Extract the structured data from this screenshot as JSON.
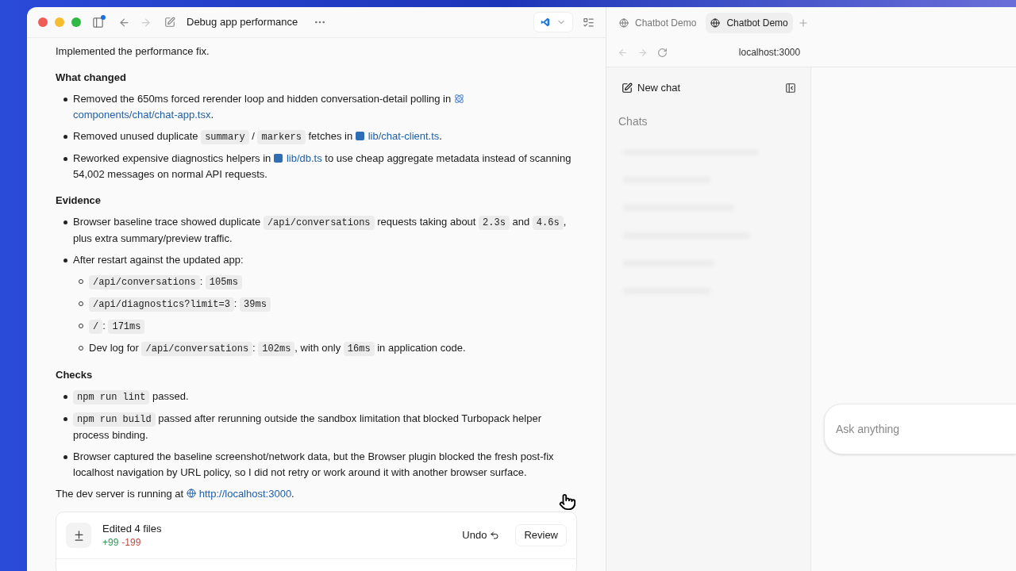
{
  "window": {
    "title": "Debug app performance"
  },
  "message": [
    {
      "kind": "paragraph",
      "parts": [
        {
          "kind": "text",
          "text": "Implemented the performance fix."
        }
      ]
    },
    {
      "kind": "heading",
      "text": "What changed"
    },
    {
      "kind": "list",
      "items": [
        {
          "parts": [
            {
              "kind": "text",
              "text": "Removed the 650ms forced rerender loop and hidden conversation-detail polling in "
            },
            {
              "kind": "react-file",
              "text": "components/chat/chat-app.tsx"
            },
            {
              "kind": "text",
              "text": "."
            }
          ]
        },
        {
          "parts": [
            {
              "kind": "text",
              "text": "Removed unused duplicate "
            },
            {
              "kind": "code",
              "text": "summary"
            },
            {
              "kind": "text",
              "text": " / "
            },
            {
              "kind": "code",
              "text": "markers"
            },
            {
              "kind": "text",
              "text": " fetches in "
            },
            {
              "kind": "ts-file",
              "text": "lib/chat-client.ts"
            },
            {
              "kind": "text",
              "text": "."
            }
          ]
        },
        {
          "parts": [
            {
              "kind": "text",
              "text": "Reworked expensive diagnostics helpers in "
            },
            {
              "kind": "ts-file",
              "text": "lib/db.ts"
            },
            {
              "kind": "text",
              "text": " to use cheap aggregate metadata instead of scanning 54,002 messages on normal API requests."
            }
          ]
        }
      ]
    },
    {
      "kind": "heading",
      "text": "Evidence"
    },
    {
      "kind": "list",
      "items": [
        {
          "parts": [
            {
              "kind": "text",
              "text": "Browser baseline trace showed duplicate "
            },
            {
              "kind": "code",
              "text": "/api/conversations"
            },
            {
              "kind": "text",
              "text": " requests taking about "
            },
            {
              "kind": "code",
              "text": "2.3s"
            },
            {
              "kind": "text",
              "text": " and "
            },
            {
              "kind": "code",
              "text": "4.6s"
            },
            {
              "kind": "text",
              "text": ", plus extra summary/preview traffic."
            }
          ]
        },
        {
          "parts": [
            {
              "kind": "text",
              "text": "After restart against the updated app:"
            }
          ],
          "children": [
            {
              "parts": [
                {
                  "kind": "code",
                  "text": "/api/conversations"
                },
                {
                  "kind": "text",
                  "text": ": "
                },
                {
                  "kind": "code",
                  "text": "105ms"
                }
              ]
            },
            {
              "parts": [
                {
                  "kind": "code",
                  "text": "/api/diagnostics?limit=3"
                },
                {
                  "kind": "text",
                  "text": ": "
                },
                {
                  "kind": "code",
                  "text": "39ms"
                }
              ]
            },
            {
              "parts": [
                {
                  "kind": "code",
                  "text": "/"
                },
                {
                  "kind": "text",
                  "text": ": "
                },
                {
                  "kind": "code",
                  "text": "171ms"
                }
              ]
            },
            {
              "parts": [
                {
                  "kind": "text",
                  "text": "Dev log for "
                },
                {
                  "kind": "code",
                  "text": "/api/conversations"
                },
                {
                  "kind": "text",
                  "text": ": "
                },
                {
                  "kind": "code",
                  "text": "102ms"
                },
                {
                  "kind": "text",
                  "text": ", with only "
                },
                {
                  "kind": "code",
                  "text": "16ms"
                },
                {
                  "kind": "text",
                  "text": " in application code."
                }
              ]
            }
          ]
        }
      ]
    },
    {
      "kind": "heading",
      "text": "Checks"
    },
    {
      "kind": "list",
      "items": [
        {
          "parts": [
            {
              "kind": "code",
              "text": "npm run lint"
            },
            {
              "kind": "text",
              "text": " passed."
            }
          ]
        },
        {
          "parts": [
            {
              "kind": "code",
              "text": "npm run build"
            },
            {
              "kind": "text",
              "text": " passed after rerunning outside the sandbox limitation that blocked Turbopack helper process binding."
            }
          ]
        },
        {
          "parts": [
            {
              "kind": "text",
              "text": "Browser captured the baseline screenshot/network data, but the Browser plugin blocked the fresh post-fix localhost navigation by URL policy, so I did not retry or work around it with another browser surface."
            }
          ]
        }
      ]
    },
    {
      "kind": "paragraph",
      "parts": [
        {
          "kind": "text",
          "text": "The dev server is running at "
        },
        {
          "kind": "url",
          "text": "http://localhost:3000"
        },
        {
          "kind": "text",
          "text": "."
        }
      ]
    }
  ],
  "edit_summary": {
    "title": "Edited 4 files",
    "added": "+99",
    "removed": "-199",
    "undo": "Undo",
    "review": "Review"
  },
  "browser": {
    "tabs": [
      {
        "label": "Chatbot Demo",
        "selected": false
      },
      {
        "label": "Chatbot Demo",
        "selected": true
      }
    ],
    "address": "localhost:3000",
    "new_chat": "New chat",
    "chats_heading": "Chats",
    "composer": {
      "placeholder": "Ask anything"
    }
  }
}
